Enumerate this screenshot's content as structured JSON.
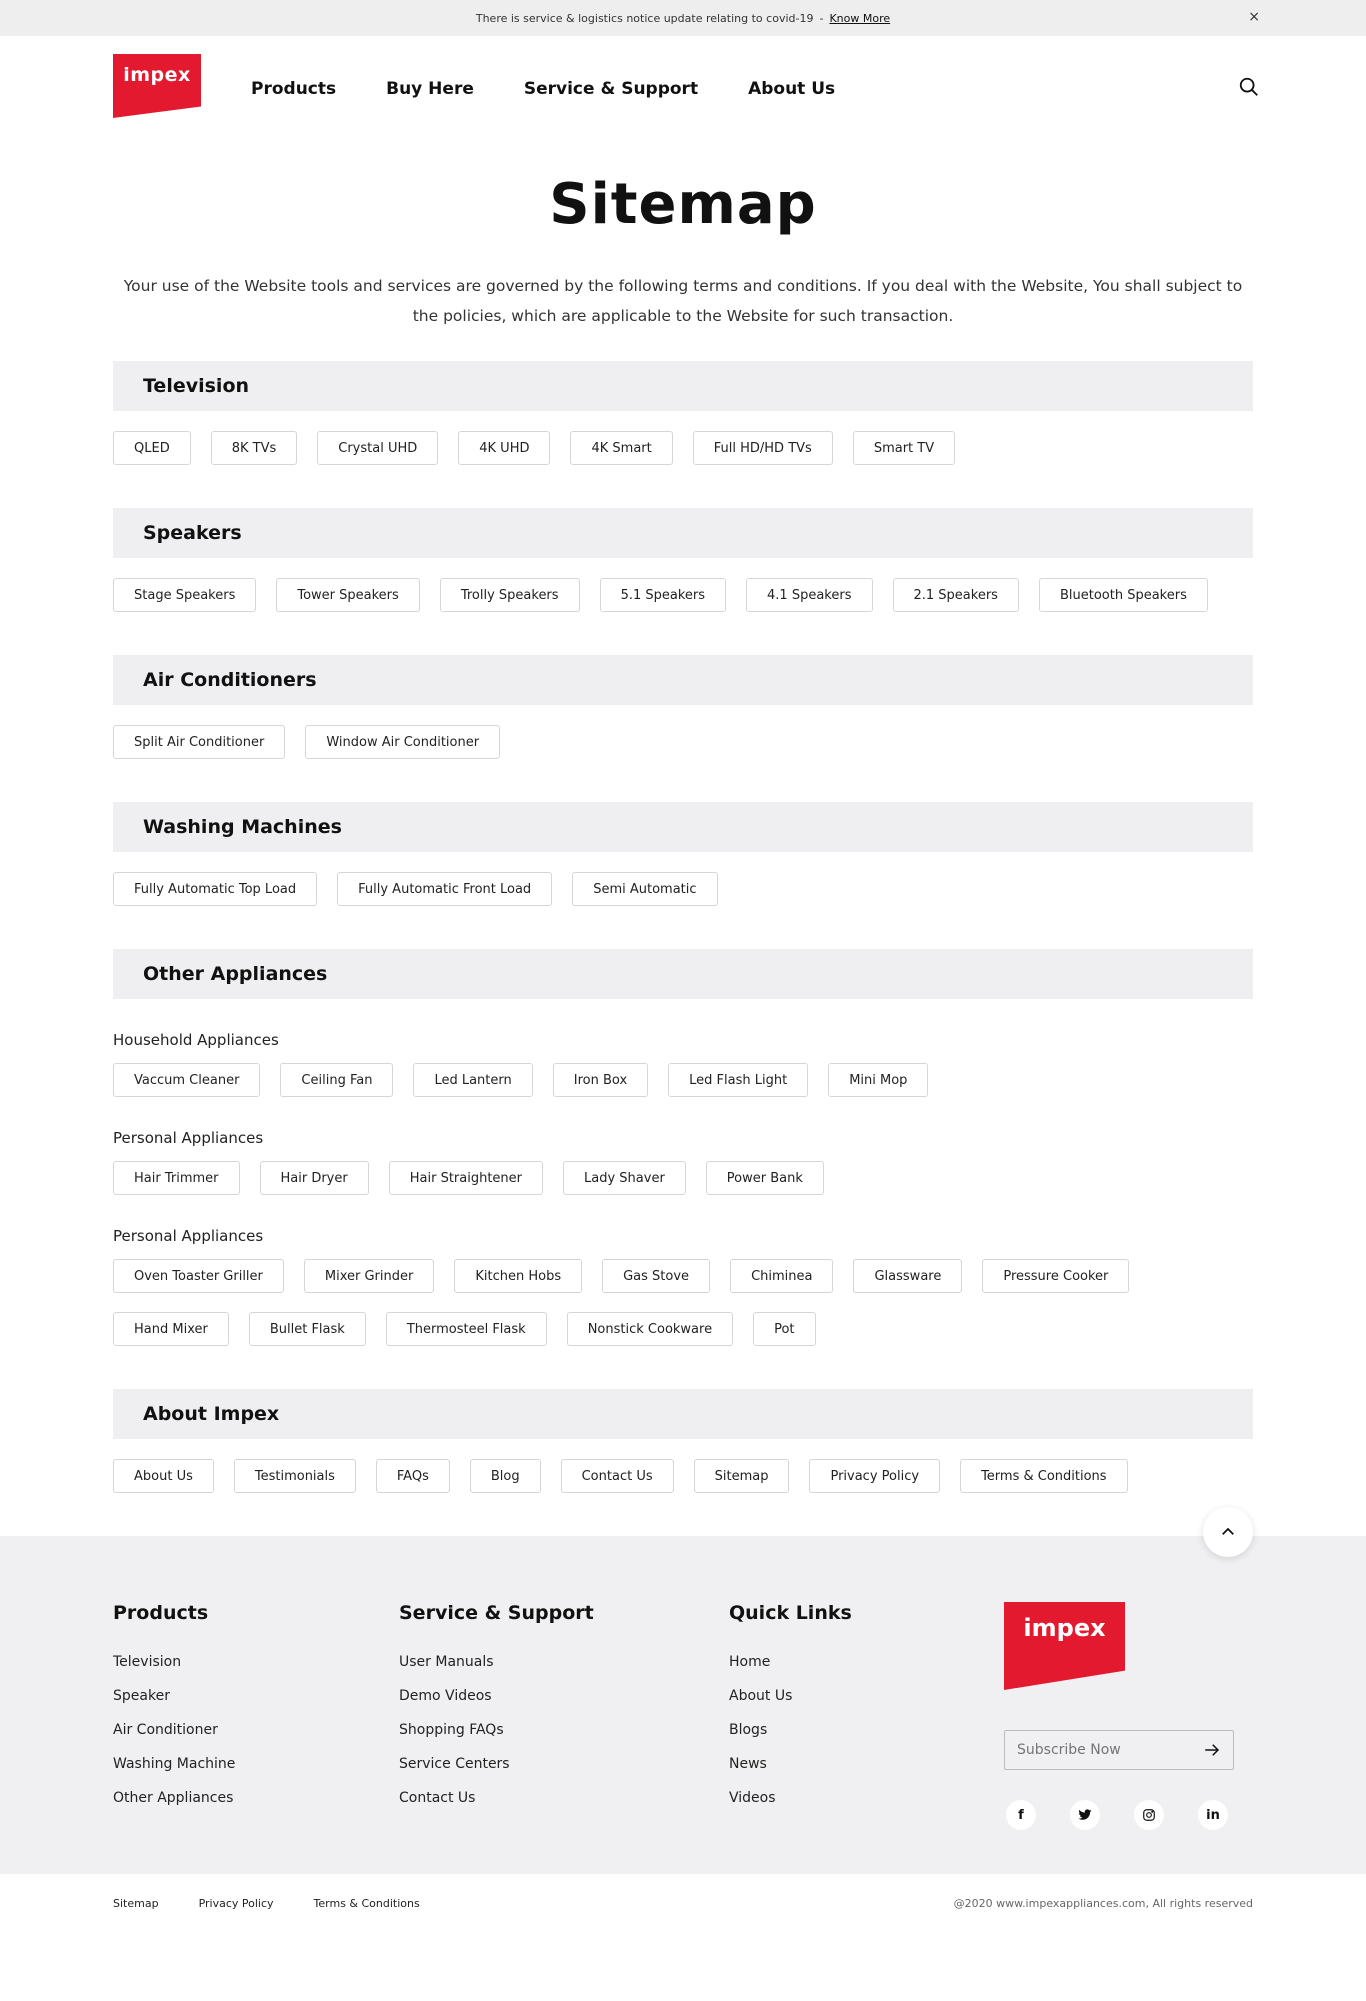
{
  "notice": {
    "text": "There is service & logistics notice update relating to covid-19",
    "sep": "-",
    "link": "Know More",
    "close": "×"
  },
  "header": {
    "logo": "impex",
    "nav": [
      "Products",
      "Buy Here",
      "Service & Support",
      "About Us"
    ]
  },
  "hero": {
    "title": "Sitemap",
    "intro": "Your use of the Website tools and services are governed by the following terms and conditions. If you deal with the Website, You shall subject to the policies, which are applicable to the Website for such transaction."
  },
  "sections": {
    "television": {
      "title": "Television",
      "items": [
        "QLED",
        "8K TVs",
        "Crystal UHD",
        "4K UHD",
        "4K Smart",
        "Full HD/HD TVs",
        "Smart TV"
      ]
    },
    "speakers": {
      "title": "Speakers",
      "items": [
        "Stage Speakers",
        "Tower Speakers",
        "Trolly Speakers",
        "5.1 Speakers",
        "4.1 Speakers",
        "2.1 Speakers",
        "Bluetooth Speakers"
      ]
    },
    "ac": {
      "title": "Air Conditioners",
      "items": [
        "Split Air Conditioner",
        "Window Air Conditioner"
      ]
    },
    "washing": {
      "title": "Washing Machines",
      "items": [
        "Fully Automatic Top Load",
        "Fully Automatic Front Load",
        "Semi Automatic"
      ]
    },
    "other": {
      "title": "Other Appliances",
      "household": {
        "title": "Household Appliances",
        "items": [
          "Vaccum Cleaner",
          "Ceiling Fan",
          "Led Lantern",
          "Iron Box",
          "Led Flash Light",
          "Mini Mop"
        ]
      },
      "personal": {
        "title": "Personal Appliances",
        "items": [
          "Hair Trimmer",
          "Hair Dryer",
          "Hair Straightener",
          "Lady Shaver",
          "Power Bank"
        ]
      },
      "kitchen": {
        "title": "Personal Appliances",
        "items": [
          "Oven Toaster Griller",
          "Mixer Grinder",
          "Kitchen Hobs",
          "Gas Stove",
          "Chiminea",
          "Glassware",
          "Pressure Cooker",
          "Hand Mixer",
          "Bullet Flask",
          "Thermosteel Flask",
          "Nonstick Cookware",
          "Pot"
        ]
      }
    },
    "about": {
      "title": "About Impex",
      "items": [
        "About Us",
        "Testimonials",
        "FAQs",
        "Blog",
        "Contact Us",
        "Sitemap",
        "Privacy Policy",
        "Terms & Conditions"
      ]
    }
  },
  "footer": {
    "products": {
      "title": "Products",
      "links": [
        "Television",
        "Speaker",
        "Air Conditioner",
        "Washing Machine",
        "Other Appliances"
      ]
    },
    "service": {
      "title": "Service & Support",
      "links": [
        "User Manuals",
        "Demo Videos",
        "Shopping FAQs",
        "Service Centers",
        "Contact Us"
      ]
    },
    "quick": {
      "title": "Quick Links",
      "links": [
        "Home",
        "About Us",
        "Blogs",
        "News",
        "Videos"
      ]
    },
    "logo": "impex",
    "subscribe_placeholder": "Subscribe Now",
    "socials": [
      "f",
      "t",
      "ig",
      "in"
    ]
  },
  "bottom": {
    "links": [
      "Sitemap",
      "Privacy Policy",
      "Terms & Conditions"
    ],
    "copyright": "@2020 www.impexappliances.com, All rights reserved"
  },
  "colors": {
    "brand": "#e3192f",
    "section_bg": "#efeff2",
    "footer_bg": "#f0f0f2"
  }
}
